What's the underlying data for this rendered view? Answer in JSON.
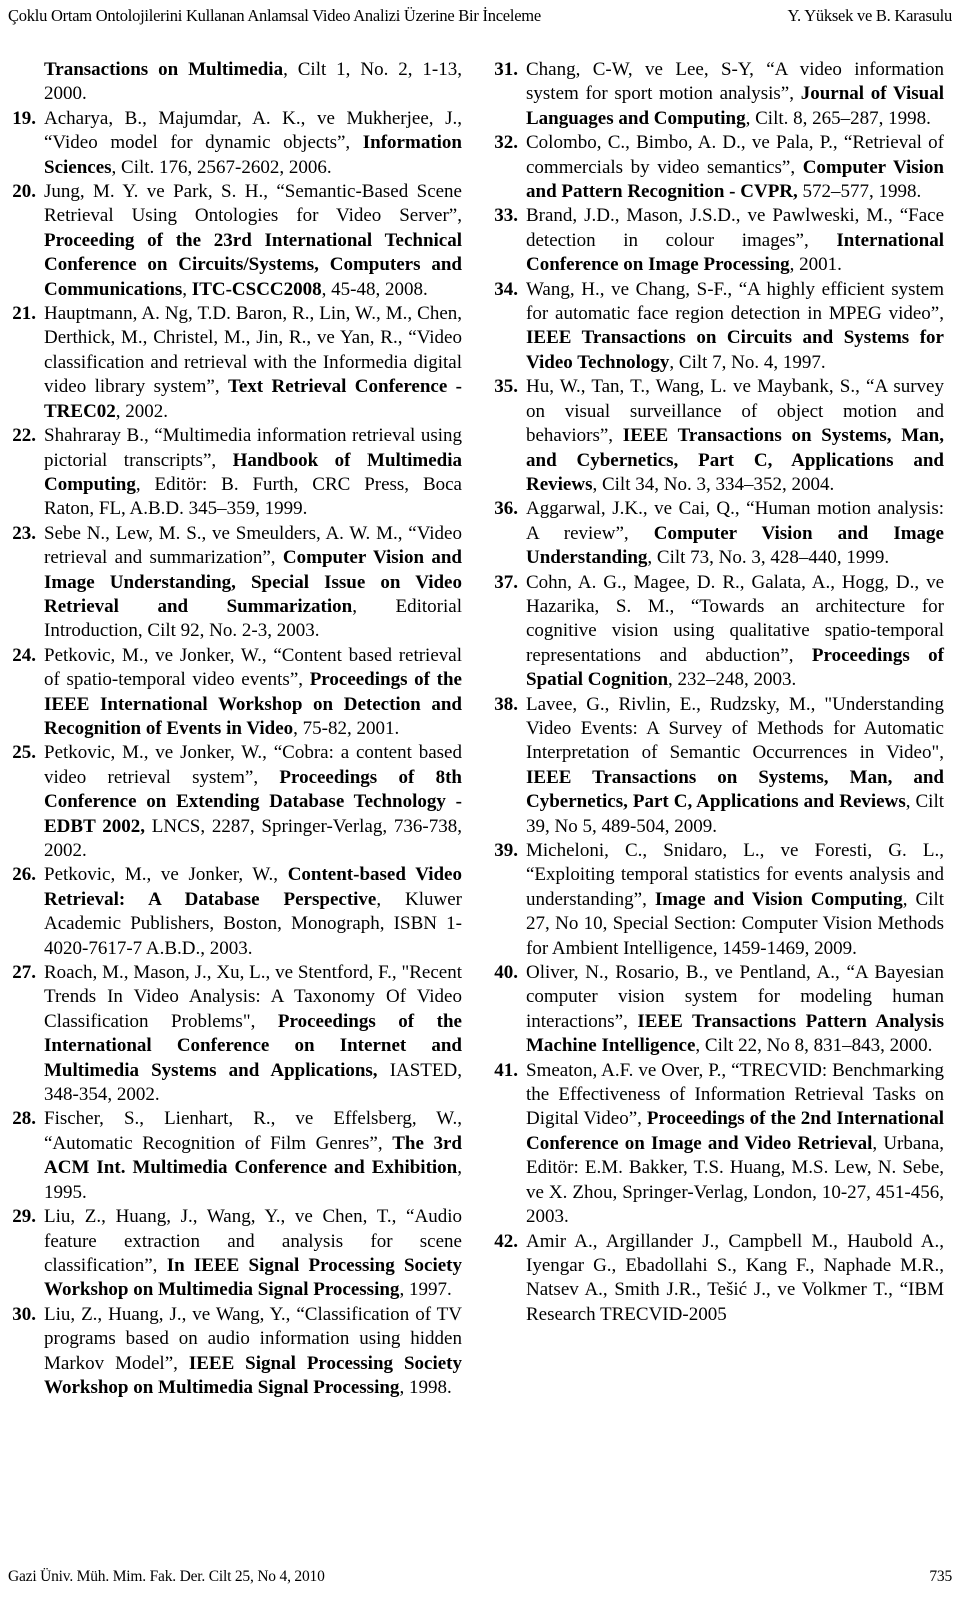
{
  "running_head": {
    "left": "Çoklu Ortam Ontolojilerini Kullanan Anlamsal Video Analizi Üzerine Bir İnceleme",
    "right": "Y. Yüksek ve B. Karasulu"
  },
  "footer": {
    "journal": "Gazi Üniv. Müh. Mim. Fak. Der. Cilt 25, No 4, 2010",
    "page_number": "735"
  },
  "left_column": {
    "continuation": "<b>Transactions on Multimedia</b>, Cilt 1, No. 2, 1-13, 2000.",
    "references": [
      {
        "number": "19.",
        "html": "Acharya, B., Majumdar, A. K., ve Mukherjee, J., “Video model for dynamic objects”, <b>Information Sciences</b>, Cilt. 176, 2567-2602, 2006."
      },
      {
        "number": "20.",
        "html": "Jung, M. Y. ve Park, S. H., “Semantic-Based Scene Retrieval Using Ontologies for Video Server”, <b>Proceeding of the 23rd International Technical Conference on Circuits/Systems, Computers and Communications</b>, <b>ITC-CSCC2008</b>, 45-48, 2008."
      },
      {
        "number": "21.",
        "html": "Hauptmann, A. Ng, T.D. Baron, R., Lin, W., M., Chen, Derthick, M., Christel, M., Jin, R., ve Yan, R., “Video classification and retrieval with the Informedia digital video library system”, <b>Text Retrieval Conference - TREC02</b>, 2002."
      },
      {
        "number": "22.",
        "html": "Shahraray B., “Multimedia information retrieval using pictorial transcripts”, <b>Handbook of Multimedia Computing</b>, Editör: B. Furth, CRC Press, Boca Raton, FL, A.B.D. 345–359, 1999."
      },
      {
        "number": "23.",
        "html": "Sebe N., Lew, M. S., ve Smeulders, A. W. M., “Video retrieval and summarization”, <b>Computer Vision and Image Understanding, Special Issue on Video Retrieval and Summarization</b>, Editorial Introduction, Cilt 92, No. 2-3, 2003."
      },
      {
        "number": "24.",
        "html": "Petkovic, M., ve Jonker, W., “Content based retrieval of spatio-temporal video events”, <b>Proceedings of the IEEE International Workshop on Detection and Recognition of Events in Video</b>, 75-82, 2001."
      },
      {
        "number": "25.",
        "html": "Petkovic, M., ve Jonker, W., “Cobra: a content based video retrieval system”, <b>Proceedings of 8th Conference on Extending Database Technology - EDBT 2002,</b> LNCS, 2287, Springer-Verlag, 736-738, 2002."
      },
      {
        "number": "26.",
        "html": "Petkovic, M., ve Jonker, W., <b>Content-based Video Retrieval: A Database Perspective</b>, Kluwer Academic Publishers, Boston, Monograph, ISBN 1-4020-7617-7 A.B.D., 2003."
      },
      {
        "number": "27.",
        "html": "Roach, M., Mason, J., Xu, L., ve Stentford, F., \"Recent Trends In Video Analysis: A Taxonomy Of Video Classification Problems\", <b>Proceedings of the International Conference on Internet and Multimedia Systems and Applications,</b> IASTED, 348-354, 2002."
      },
      {
        "number": "28.",
        "html": "Fischer, S., Lienhart, R., ve Effelsberg, W., “Automatic Recognition of Film Genres”, <b>The 3rd ACM Int. Multimedia Conference and Exhibition</b>, 1995."
      },
      {
        "number": "29.",
        "html": "Liu, Z., Huang, J., Wang, Y., ve Chen, T., “Audio feature extraction and analysis for scene classification”, <b>In IEEE Signal Processing Society Workshop on Multimedia Signal Processing</b>, 1997."
      },
      {
        "number": "30.",
        "html": "Liu, Z., Huang, J., ve Wang, Y., “Classification of TV programs based on audio information using hidden Markov Model”, <b>IEEE Signal Processing Society Workshop on Multimedia Signal Processing</b>, 1998."
      }
    ]
  },
  "right_column": {
    "references": [
      {
        "number": "31.",
        "html": "Chang, C-W, ve Lee, S-Y, “A video information system for sport motion analysis”, <b>Journal of Visual Languages and Computing</b>, Cilt. 8, 265–287, 1998."
      },
      {
        "number": "32.",
        "html": "Colombo, C., Bimbo, A. D., ve Pala, P., “Retrieval of commercials by video semantics”, <b>Computer Vision and Pattern Recognition - CVPR,</b> 572–577, 1998."
      },
      {
        "number": "33.",
        "html": "Brand, J.D., Mason, J.S.D., ve Pawlweski, M., “Face detection in colour images”, <b>International Conference on Image Processing</b>, 2001."
      },
      {
        "number": "34.",
        "html": "Wang, H., ve Chang, S-F., “A highly efficient system for automatic face region detection in MPEG video”, <b>IEEE Transactions on Circuits and Systems for Video Technology</b>, Cilt 7, No. 4, 1997."
      },
      {
        "number": "35.",
        "html": "Hu, W., Tan, T., Wang, L. ve Maybank, S., “A survey on visual surveillance of object motion and behaviors”, <b>IEEE Transactions on Systems, Man, and Cybernetics, Part C, Applications and Reviews</b>, Cilt 34, No. 3, 334–352, 2004."
      },
      {
        "number": "36.",
        "html": "Aggarwal, J.K., ve Cai, Q., “Human motion analysis: A review”, <b>Computer Vision and Image Understanding</b>, Cilt 73, No. 3, 428–440, 1999."
      },
      {
        "number": "37.",
        "html": "Cohn, A. G., Magee, D. R., Galata, A., Hogg, D., ve Hazarika, S. M., “Towards an architecture for cognitive vision using qualitative spatio-temporal representations and abduction”, <b>Proceedings of Spatial Cognition</b>, 232–248, 2003."
      },
      {
        "number": "38.",
        "html": "Lavee, G., Rivlin, E., Rudzsky, M., \"Understanding Video Events: A Survey of Methods for Automatic Interpretation of Semantic Occurrences in Video\", <b>IEEE Transactions on Systems, Man, and Cybernetics, Part C, Applications and Reviews</b>, Cilt 39, No 5, 489-504, 2009."
      },
      {
        "number": "39.",
        "html": "Micheloni, C., Snidaro, L., ve Foresti, G. L., “Exploiting temporal statistics for events analysis and understanding”, <b>Image and Vision Computing</b>, Cilt 27, No 10, Special Section: Computer Vision Methods for Ambient Intelligence, 1459-1469, 2009."
      },
      {
        "number": "40.",
        "html": "Oliver, N., Rosario, B., ve Pentland, A., “A Bayesian computer vision system for modeling human interactions”, <b>IEEE Transactions Pattern Analysis Machine Intelligence</b>, Cilt 22, No 8, 831–843, 2000."
      },
      {
        "number": "41.",
        "html": "Smeaton, A.F. ve Over, P., “TRECVID: Benchmarking the Effectiveness of Information Retrieval Tasks on Digital Video”, <b>Proceedings of the 2nd International Conference on Image and Video Retrieval</b>, Urbana, Editör: E.M. Bakker, T.S. Huang, M.S. Lew, N. Sebe, ve X. Zhou, Springer-Verlag, London, 10-27, 451-456, 2003."
      },
      {
        "number": "42.",
        "html": "Amir A., Argillander J., Campbell M., Haubold A., Iyengar G., Ebadollahi S., Kang F., Naphade M.R., Natsev A., Smith J.R., Tešić J., ve Volkmer T., “IBM Research TRECVID-2005"
      }
    ]
  }
}
